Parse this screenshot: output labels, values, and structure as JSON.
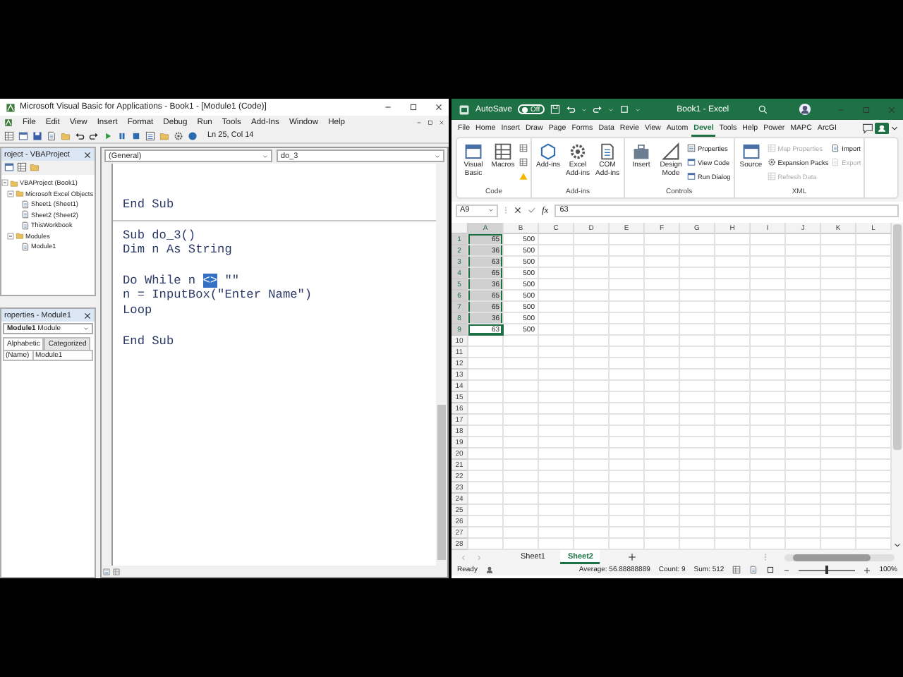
{
  "vba": {
    "title": "Microsoft Visual Basic for Applications - Book1 - [Module1 (Code)]",
    "menu": [
      "File",
      "Edit",
      "View",
      "Insert",
      "Format",
      "Debug",
      "Run",
      "Tools",
      "Add-Ins",
      "Window",
      "Help"
    ],
    "position": "Ln 25, Col 14",
    "project": {
      "title": "roject - VBAProject",
      "tree": [
        {
          "label": "VBAProject (Book1)",
          "expanded": true,
          "children": [
            {
              "label": "Microsoft Excel Objects",
              "expanded": true,
              "children": [
                {
                  "label": "Sheet1 (Sheet1)"
                },
                {
                  "label": "Sheet2 (Sheet2)"
                },
                {
                  "label": "ThisWorkbook"
                }
              ]
            },
            {
              "label": "Modules",
              "expanded": true,
              "children": [
                {
                  "label": "Module1"
                }
              ]
            }
          ]
        }
      ]
    },
    "properties": {
      "title": "roperties - Module1",
      "object": {
        "name": "Module1",
        "type": "Module"
      },
      "tabs": [
        {
          "label": "Alphabetic",
          "selected": true
        },
        {
          "label": "Categorized",
          "selected": false
        }
      ],
      "rows": [
        {
          "name": "(Name)",
          "value": "Module1"
        }
      ]
    },
    "code": {
      "object": "(General)",
      "procedure": "do_3",
      "procedures": [
        {
          "blocks": [
            [
              {
                "text": "End Sub"
              }
            ]
          ]
        },
        {
          "blocks": [
            [
              {
                "text": "Sub do_3()"
              },
              {
                "text": "Dim n As String"
              }
            ],
            [
              {
                "text": "Do While n ",
                "selection": "<>",
                "after": " \"\""
              },
              {
                "text": "n = InputBox(\"Enter Name\")"
              },
              {
                "text": "Loop"
              }
            ],
            [
              {
                "text": "End Sub"
              }
            ]
          ]
        }
      ]
    }
  },
  "excel": {
    "title": "Book1 - Excel",
    "autosave": {
      "label": "AutoSave",
      "on": false,
      "state": "Off"
    },
    "tabs": [
      {
        "label": "File",
        "selected": false
      },
      {
        "label": "Home",
        "selected": false
      },
      {
        "label": "Insert",
        "selected": false
      },
      {
        "label": "Draw",
        "selected": false
      },
      {
        "label": "Page",
        "selected": false
      },
      {
        "label": "Forms",
        "selected": false
      },
      {
        "label": "Data",
        "selected": false
      },
      {
        "label": "Revie",
        "selected": false
      },
      {
        "label": "View",
        "selected": false
      },
      {
        "label": "Autom",
        "selected": false
      },
      {
        "label": "Devel",
        "selected": true
      },
      {
        "label": "Tools",
        "selected": false
      },
      {
        "label": "Help",
        "selected": false
      },
      {
        "label": "Power",
        "selected": false
      },
      {
        "label": "MAPC",
        "selected": false
      },
      {
        "label": "ArcGI",
        "selected": false
      }
    ],
    "ribbon": [
      {
        "label": "Code",
        "buttons": [
          {
            "kind": "large",
            "label": "Visual Basic",
            "disabled": false
          },
          {
            "kind": "large",
            "label": "Macros",
            "disabled": false
          },
          {
            "kind": "icon",
            "disabled": false
          },
          {
            "kind": "icon",
            "disabled": false
          },
          {
            "kind": "icon",
            "disabled": false
          }
        ]
      },
      {
        "label": "Add-ins",
        "buttons": [
          {
            "kind": "large",
            "label": "Add-ins",
            "disabled": false
          },
          {
            "kind": "large",
            "label": "Excel Add-ins",
            "disabled": false
          },
          {
            "kind": "large",
            "label": "COM Add-ins",
            "disabled": false
          }
        ]
      },
      {
        "label": "Controls",
        "buttons": [
          {
            "kind": "large",
            "label": "Insert",
            "disabled": false
          },
          {
            "kind": "large",
            "label": "Design Mode",
            "disabled": false
          },
          {
            "kind": "small",
            "label": "Properties",
            "disabled": false
          },
          {
            "kind": "small",
            "label": "View Code",
            "disabled": false
          },
          {
            "kind": "small",
            "label": "Run Dialog",
            "disabled": false
          }
        ]
      },
      {
        "label": "XML",
        "buttons": [
          {
            "kind": "large",
            "label": "Source",
            "disabled": false
          },
          {
            "kind": "small",
            "label": "Map Properties",
            "disabled": true
          },
          {
            "kind": "small",
            "label": "Expansion Packs",
            "disabled": false
          },
          {
            "kind": "small",
            "label": "Refresh Data",
            "disabled": true
          },
          {
            "kind": "small",
            "label": "Import",
            "disabled": false
          },
          {
            "kind": "small",
            "label": "Export",
            "disabled": true
          }
        ]
      }
    ],
    "formula_bar": {
      "name_box": "A9",
      "function_label": "fx",
      "value": "63"
    },
    "columns": [
      "A",
      "B",
      "C",
      "D",
      "E",
      "F",
      "G",
      "H",
      "I",
      "J",
      "K",
      "L"
    ],
    "rows": [
      {
        "number": "1",
        "cells": [
          {
            "value": "65",
            "selected": true,
            "active": false
          },
          {
            "value": "500",
            "selected": false,
            "active": false
          }
        ]
      },
      {
        "number": "2",
        "cells": [
          {
            "value": "36",
            "selected": true,
            "active": false
          },
          {
            "value": "500",
            "selected": false,
            "active": false
          }
        ]
      },
      {
        "number": "3",
        "cells": [
          {
            "value": "63",
            "selected": true,
            "active": false
          },
          {
            "value": "500",
            "selected": false,
            "active": false
          }
        ]
      },
      {
        "number": "4",
        "cells": [
          {
            "value": "65",
            "selected": true,
            "active": false
          },
          {
            "value": "500",
            "selected": false,
            "active": false
          }
        ]
      },
      {
        "number": "5",
        "cells": [
          {
            "value": "36",
            "selected": true,
            "active": false
          },
          {
            "value": "500",
            "selected": false,
            "active": false
          }
        ]
      },
      {
        "number": "6",
        "cells": [
          {
            "value": "65",
            "selected": true,
            "active": false
          },
          {
            "value": "500",
            "selected": false,
            "active": false
          }
        ]
      },
      {
        "number": "7",
        "cells": [
          {
            "value": "65",
            "selected": true,
            "active": false
          },
          {
            "value": "500",
            "selected": false,
            "active": false
          }
        ]
      },
      {
        "number": "8",
        "cells": [
          {
            "value": "36",
            "selected": true,
            "active": false
          },
          {
            "value": "500",
            "selected": false,
            "active": false
          }
        ]
      },
      {
        "number": "9",
        "cells": [
          {
            "value": "63",
            "selected": true,
            "active": true
          },
          {
            "value": "500",
            "selected": false,
            "active": false
          }
        ]
      },
      {
        "number": "10"
      },
      {
        "number": "11"
      },
      {
        "number": "12"
      },
      {
        "number": "13"
      },
      {
        "number": "14"
      },
      {
        "number": "15"
      },
      {
        "number": "16"
      },
      {
        "number": "17"
      },
      {
        "number": "18"
      },
      {
        "number": "19"
      },
      {
        "number": "20"
      },
      {
        "number": "21"
      },
      {
        "number": "22"
      },
      {
        "number": "23"
      },
      {
        "number": "24"
      },
      {
        "number": "25"
      },
      {
        "number": "26"
      },
      {
        "number": "27"
      },
      {
        "number": "28"
      }
    ],
    "sheets": [
      {
        "label": "Sheet1",
        "selected": false
      },
      {
        "label": "Sheet2",
        "selected": true
      }
    ],
    "status": {
      "mode": "Ready",
      "stats": [
        "Average: 56.88888889",
        "Count: 9",
        "Sum: 512"
      ],
      "zoom": {
        "level": 0.5,
        "reading": "100%"
      }
    }
  }
}
